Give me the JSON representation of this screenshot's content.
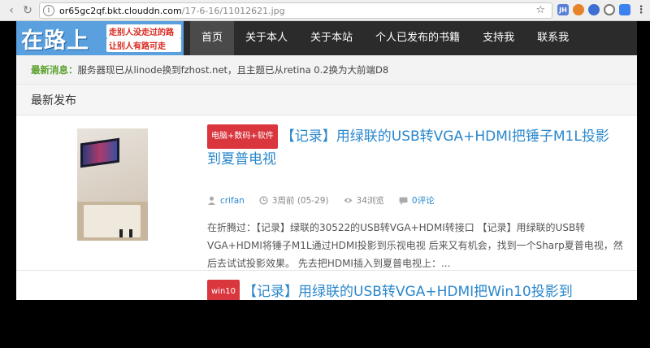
{
  "browser": {
    "url_host": "or65gc2qf.bkt.clouddn.com",
    "url_path": "/17-6-16/11012621.jpg",
    "extensions": [
      {
        "name": "jh-extension-icon",
        "label": "JH",
        "color": "#5b7fd6"
      },
      {
        "name": "fox-extension-icon",
        "label": "",
        "color": "#e8822a"
      },
      {
        "name": "shield-extension-icon",
        "label": "",
        "color": "#3c6fd1"
      },
      {
        "name": "circle-extension-icon",
        "label": "",
        "color": "#777777"
      },
      {
        "name": "translate-extension-icon",
        "label": "",
        "color": "#3b82f0"
      },
      {
        "name": "green-extension-icon",
        "label": "",
        "color": "#47a447"
      },
      {
        "name": "circle-gray-extension-icon",
        "label": "",
        "color": "#9a9a9a"
      }
    ]
  },
  "site": {
    "logo_text": "在路上",
    "logo_slogan_1": "走别人没走过的路",
    "logo_slogan_2": "让别人有路可走",
    "menu": [
      "首页",
      "关于本人",
      "关于本站",
      "个人已发布的书籍",
      "支持我",
      "联系我"
    ],
    "active_menu": 0
  },
  "news": {
    "label": "最新消息：",
    "text": "服务器现已从linode换到fzhost.net，且主题已从retina 0.2换为大前端D8"
  },
  "section": {
    "title": "最新发布"
  },
  "posts": [
    {
      "category": "电脑+数码+软件",
      "title": "【记录】用绿联的USB转VGA+HDMI把锤子M1L投影到夏普电视",
      "author": "crifan",
      "time": "3周前 (05-29)",
      "views": "34浏览",
      "comments": "0评论",
      "excerpt": "在折腾过：【记录】绿联的30522的USB转VGA+HDMI转接口 【记录】用绿联的USB转VGA+HDMI将锤子M1L通过HDMI投影到乐视电视 后来又有机会，找到一个Sharp夏普电视，然后去试试投影效果。 先去把HDMI插入到夏普电视上：..."
    },
    {
      "category": "win10",
      "title": "【记录】用绿联的USB转VGA+HDMI把Win10投影到"
    }
  ],
  "colors": {
    "accent": "#2a87cc",
    "badge": "#d9363e",
    "header": "#2b2b2b",
    "news_label": "#5aa02c"
  }
}
